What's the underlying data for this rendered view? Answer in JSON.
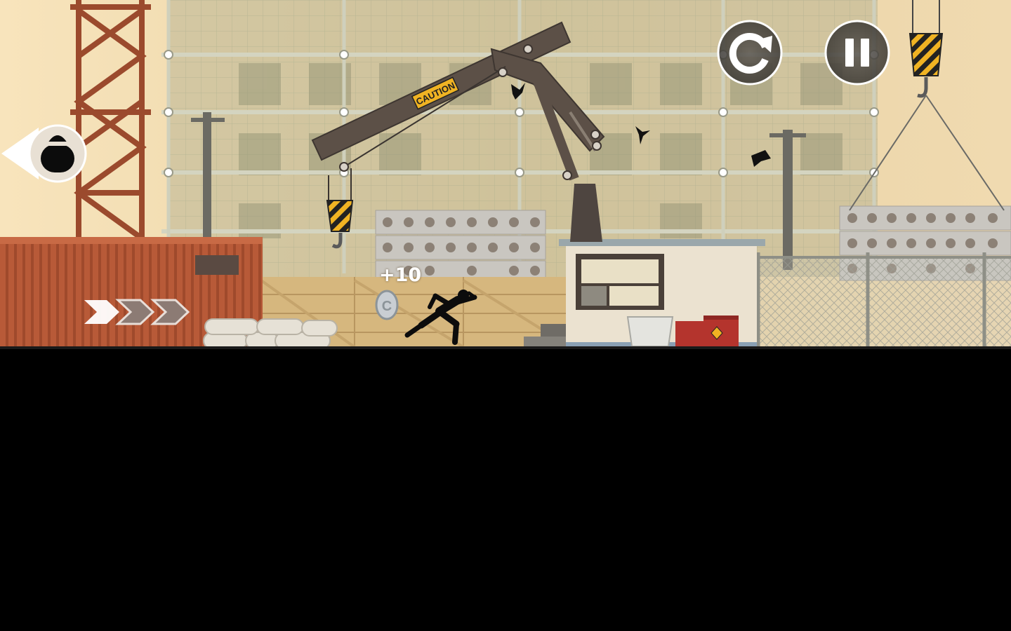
{
  "game": {
    "title": "",
    "level_theme": "construction-site"
  },
  "hud": {
    "restart_button": {
      "icon": "restart-icon"
    },
    "pause_button": {
      "icon": "pause-icon"
    },
    "chaser_indicator": {
      "icon": "hunter-head-icon",
      "direction": "left"
    },
    "speed_chevrons": {
      "icon": "chevron-right-icon",
      "count": 3
    }
  },
  "popup": {
    "score_text": "+10"
  },
  "signs": {
    "crane_caution": "CAUTION"
  },
  "colors": {
    "sky": "#f3dcb0",
    "container": "#b85a38",
    "fence": "#d6b77e",
    "crane_arm": "#5c5047",
    "tower_crane": "#9b4a2d",
    "hazard_yellow": "#f0b323",
    "ground": "#000000"
  }
}
